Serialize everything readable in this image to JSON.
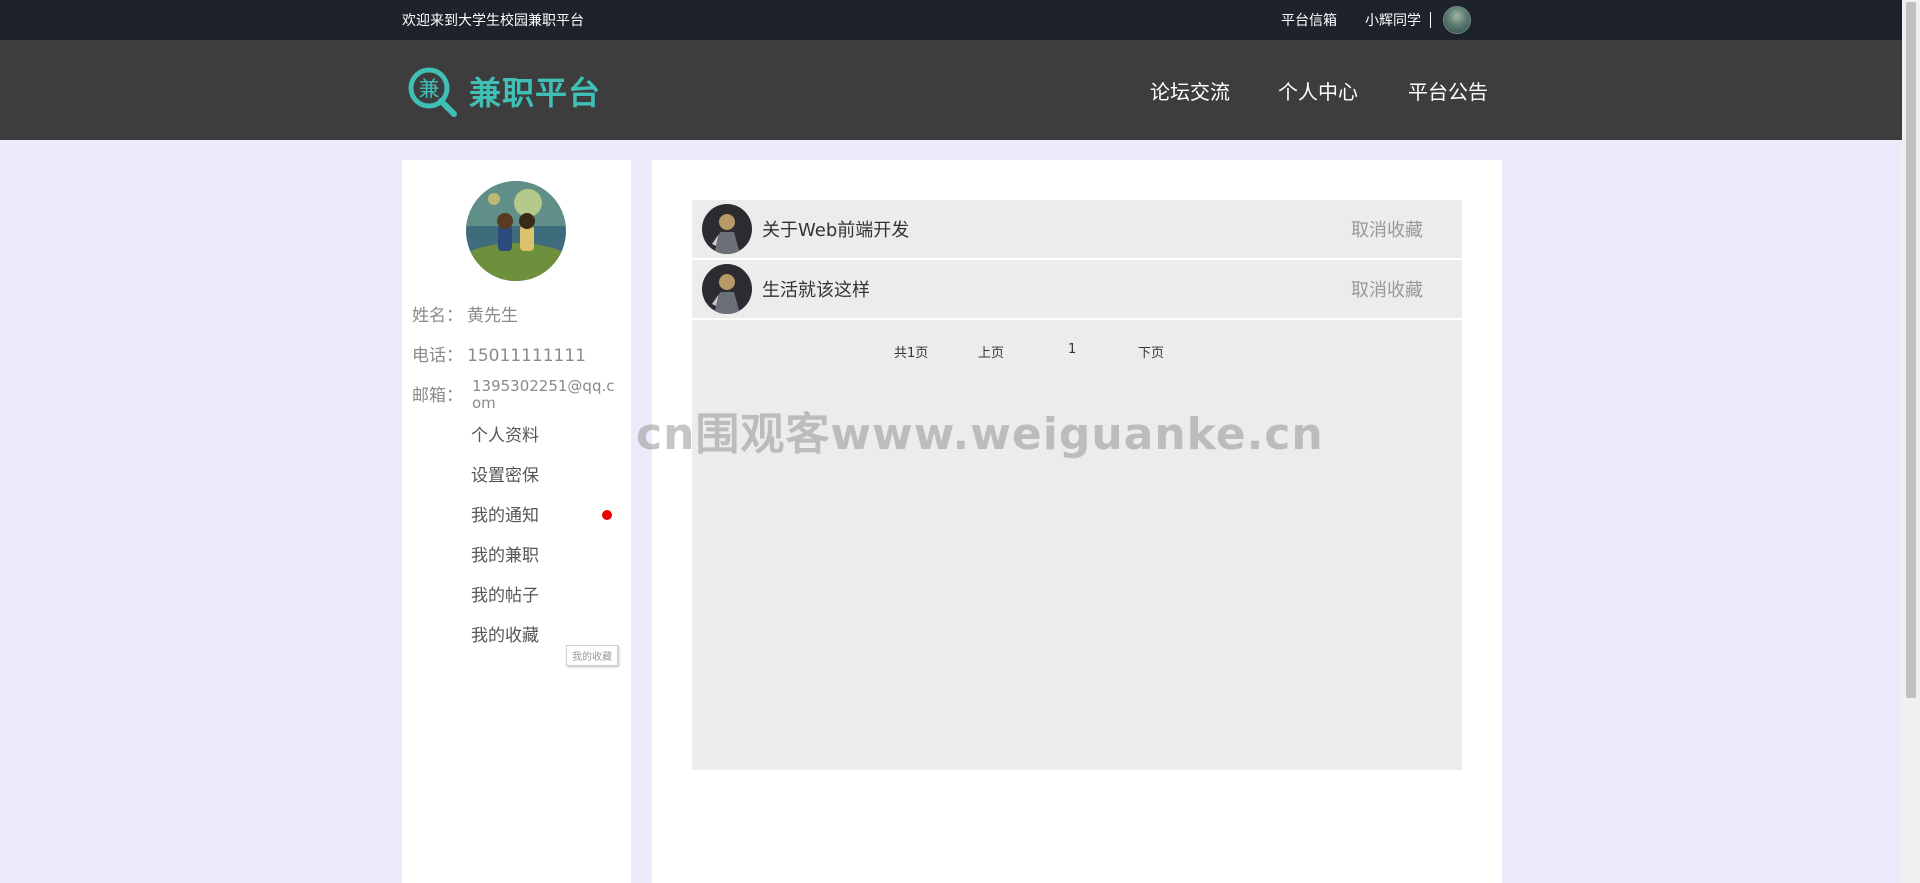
{
  "topbar": {
    "welcome": "欢迎来到大学生校园兼职平台",
    "mailbox": "平台信箱",
    "username": "小辉同学"
  },
  "header": {
    "logo_char": "兼",
    "logo_text": "兼职平台",
    "nav": [
      "论坛交流",
      "个人中心",
      "平台公告"
    ]
  },
  "profile": {
    "name_label": "姓名：",
    "name": "黄先生",
    "phone_label": "电话：",
    "phone": "15011111111",
    "email_label": "邮箱：",
    "email": "1395302251@qq.com"
  },
  "menu": [
    "个人资料",
    "设置密保",
    "我的通知",
    "我的兼职",
    "我的帖子",
    "我的收藏"
  ],
  "tooltip": "我的收藏",
  "favorites": [
    {
      "title": "关于Web前端开发",
      "action": "取消收藏"
    },
    {
      "title": "生活就该这样",
      "action": "取消收藏"
    }
  ],
  "pagination": {
    "total": "共1页",
    "prev": "上页",
    "current": "1",
    "next": "下页"
  },
  "watermark": "cn围观客www.weiguanke.cn",
  "colors": {
    "brand": "#3fbfb5",
    "topbar_bg": "#1e222b",
    "header_bg": "#3d3d3d",
    "page_bg": "#ecebfb",
    "notice_dot": "#ee0000"
  }
}
